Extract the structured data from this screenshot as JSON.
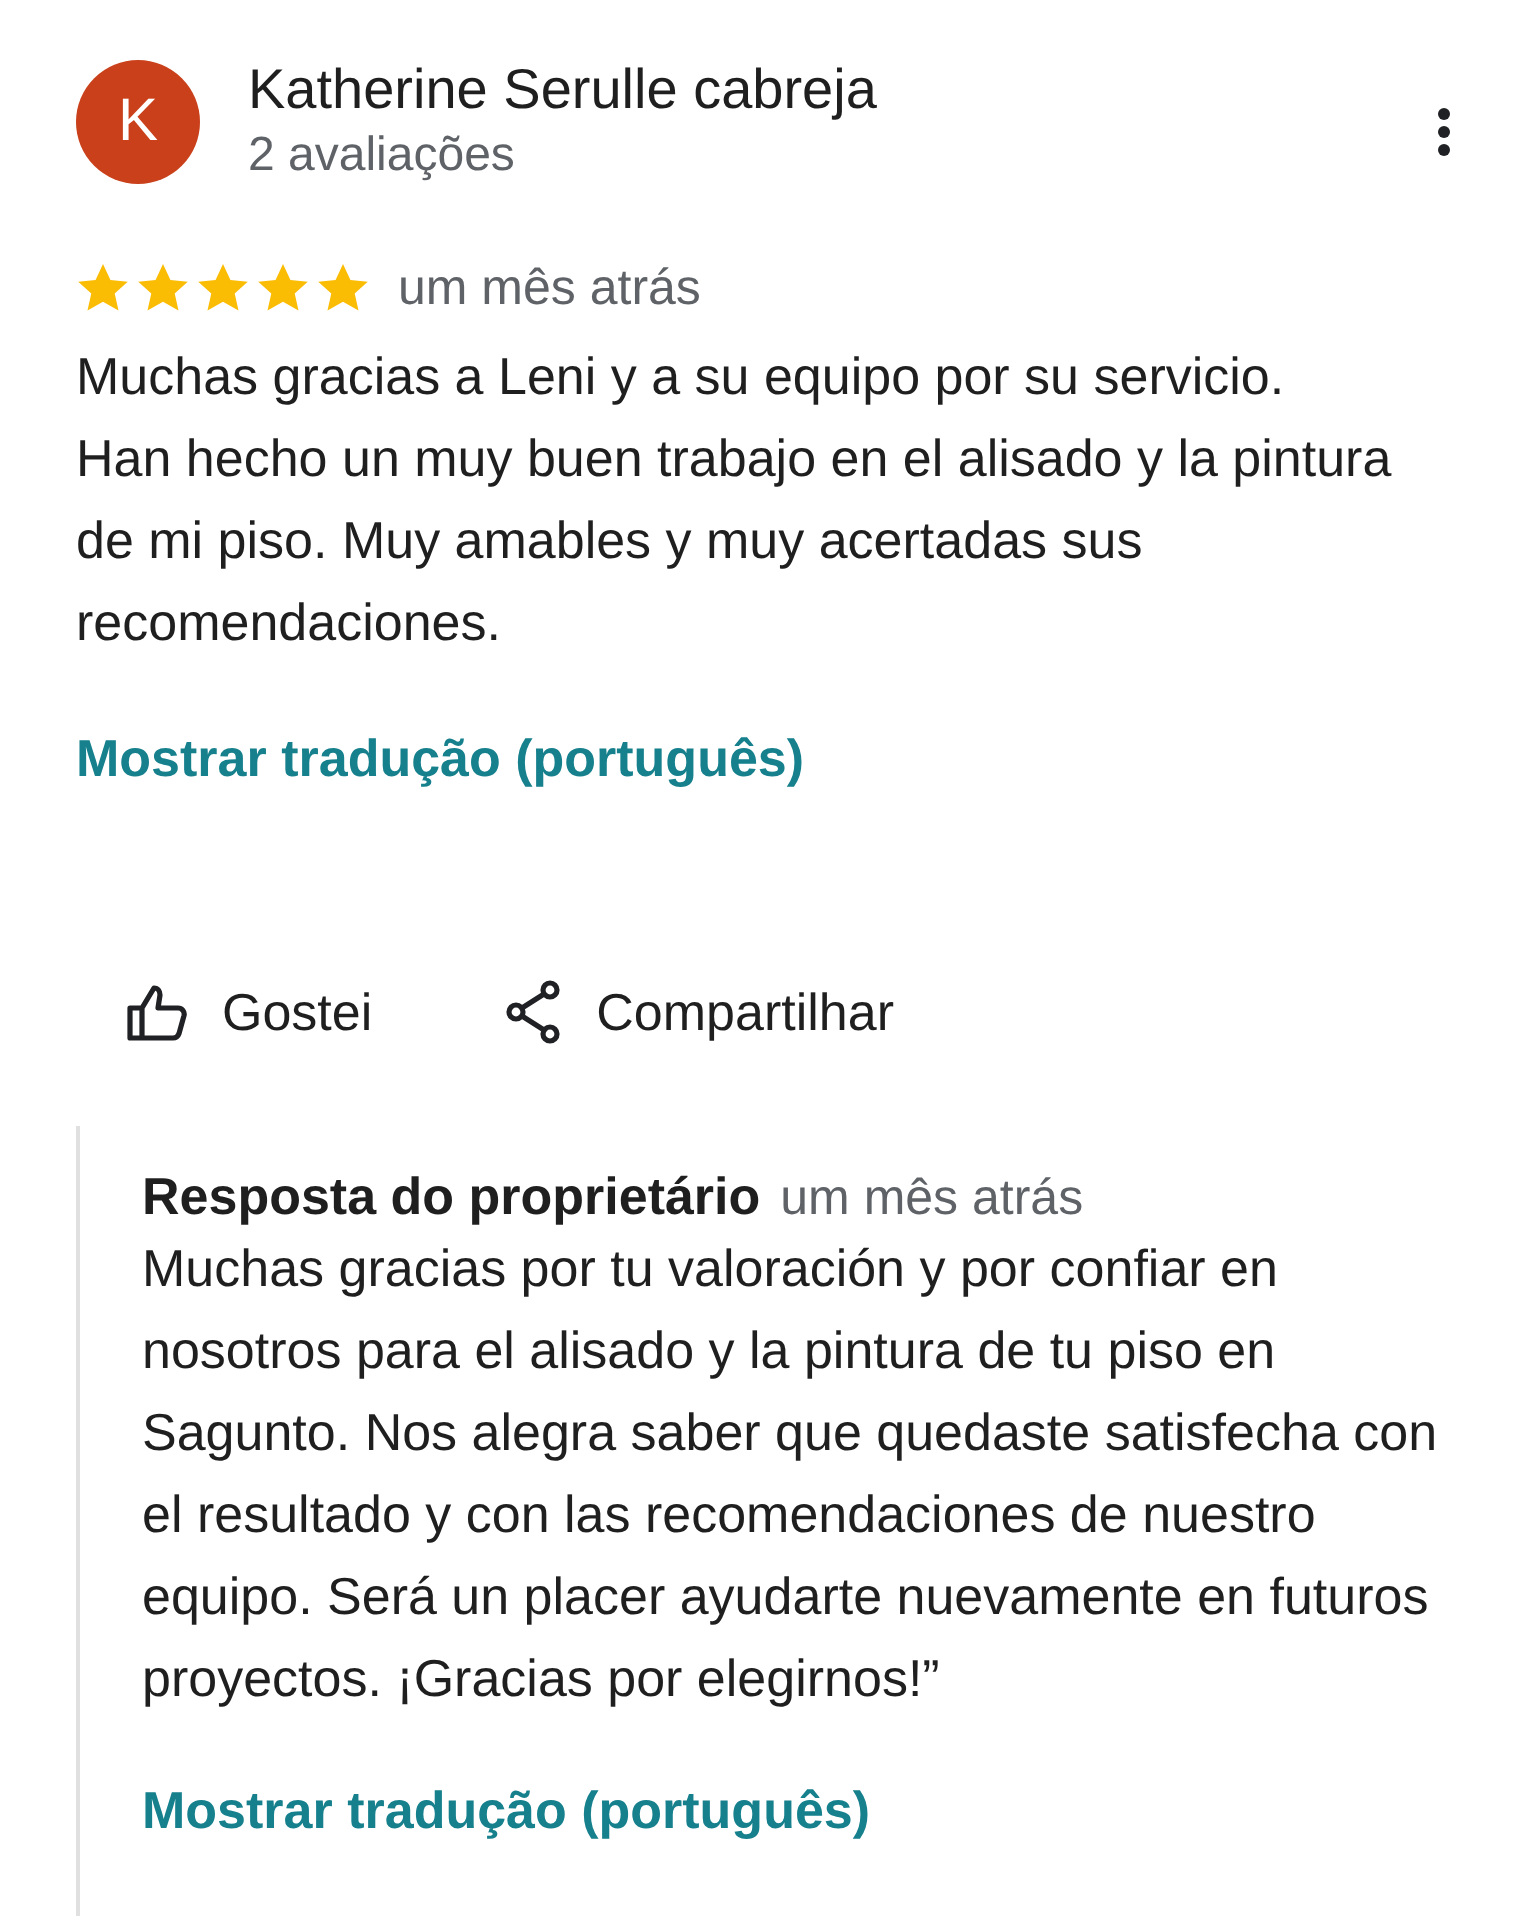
{
  "reviewer": {
    "initial": "K",
    "name": "Katherine Serulle cabreja",
    "review_count": "2 avaliações"
  },
  "review": {
    "stars": 5,
    "time": "um mês atrás",
    "text": "Muchas gracias a Leni y a su equipo por su servicio.\nHan hecho un muy buen trabajo en el alisado y la pintura de mi piso. Muy amables y muy acertadas sus recomendaciones.",
    "translate_link": "Mostrar tradução (português)"
  },
  "actions": [
    {
      "kind": "like",
      "label": "Gostei"
    },
    {
      "kind": "share",
      "label": "Compartilhar"
    }
  ],
  "owner_response": {
    "title": "Resposta do proprietário",
    "time": "um mês atrás",
    "text": "Muchas gracias por tu valoración y por confiar en nosotros para el alisado y la pintura de tu piso en Sagunto. Nos alegra saber que quedaste satisfecha con el resultado y con las recomendaciones de nuestro equipo. Será un placer ayudarte nuevamente en futuros proyectos. ¡Gracias por elegirnos!”",
    "translate_link": "Mostrar tradução (português)"
  }
}
